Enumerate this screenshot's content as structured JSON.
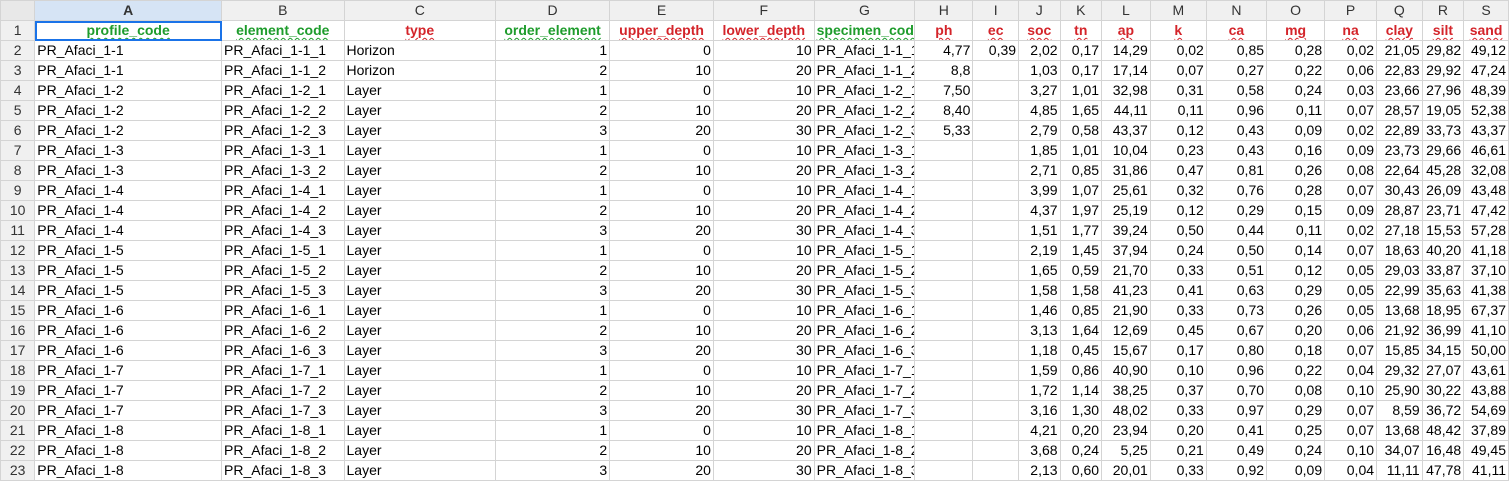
{
  "columns": [
    "A",
    "B",
    "C",
    "D",
    "E",
    "F",
    "G",
    "H",
    "I",
    "J",
    "K",
    "L",
    "M",
    "N",
    "O",
    "P",
    "Q",
    "R",
    "S"
  ],
  "headers": [
    {
      "text": "profile_code",
      "color": "g"
    },
    {
      "text": "element_code",
      "color": "g"
    },
    {
      "text": "type",
      "color": "r"
    },
    {
      "text": "order_element",
      "color": "g"
    },
    {
      "text": "upper_depth",
      "color": "r"
    },
    {
      "text": "lower_depth",
      "color": "r"
    },
    {
      "text": "specimen_code",
      "color": "g"
    },
    {
      "text": "ph",
      "color": "r"
    },
    {
      "text": "ec",
      "color": "r"
    },
    {
      "text": "soc",
      "color": "r"
    },
    {
      "text": "tn",
      "color": "r"
    },
    {
      "text": "ap",
      "color": "r"
    },
    {
      "text": "k",
      "color": "r"
    },
    {
      "text": "ca",
      "color": "r"
    },
    {
      "text": "mg",
      "color": "r"
    },
    {
      "text": "na",
      "color": "r"
    },
    {
      "text": "clay",
      "color": "r"
    },
    {
      "text": "silt",
      "color": "r"
    },
    {
      "text": "sand",
      "color": "r"
    }
  ],
  "rows": [
    [
      "PR_Afaci_1-1",
      "PR_Afaci_1-1_1",
      "Horizon",
      "1",
      "0",
      "10",
      "PR_Afaci_1-1_1",
      "4,77",
      "0,39",
      "2,02",
      "0,17",
      "14,29",
      "0,02",
      "0,85",
      "0,28",
      "0,02",
      "21,05",
      "29,82",
      "49,12"
    ],
    [
      "PR_Afaci_1-1",
      "PR_Afaci_1-1_2",
      "Horizon",
      "2",
      "10",
      "20",
      "PR_Afaci_1-1_2",
      "8,8",
      "",
      "1,03",
      "0,17",
      "17,14",
      "0,07",
      "0,27",
      "0,22",
      "0,06",
      "22,83",
      "29,92",
      "47,24"
    ],
    [
      "PR_Afaci_1-2",
      "PR_Afaci_1-2_1",
      "Layer",
      "1",
      "0",
      "10",
      "PR_Afaci_1-2_1",
      "7,50",
      "",
      "3,27",
      "1,01",
      "32,98",
      "0,31",
      "0,58",
      "0,24",
      "0,03",
      "23,66",
      "27,96",
      "48,39"
    ],
    [
      "PR_Afaci_1-2",
      "PR_Afaci_1-2_2",
      "Layer",
      "2",
      "10",
      "20",
      "PR_Afaci_1-2_2",
      "8,40",
      "",
      "4,85",
      "1,65",
      "44,11",
      "0,11",
      "0,96",
      "0,11",
      "0,07",
      "28,57",
      "19,05",
      "52,38"
    ],
    [
      "PR_Afaci_1-2",
      "PR_Afaci_1-2_3",
      "Layer",
      "3",
      "20",
      "30",
      "PR_Afaci_1-2_3",
      "5,33",
      "",
      "2,79",
      "0,58",
      "43,37",
      "0,12",
      "0,43",
      "0,09",
      "0,02",
      "22,89",
      "33,73",
      "43,37"
    ],
    [
      "PR_Afaci_1-3",
      "PR_Afaci_1-3_1",
      "Layer",
      "1",
      "0",
      "10",
      "PR_Afaci_1-3_1",
      "",
      "",
      "1,85",
      "1,01",
      "10,04",
      "0,23",
      "0,43",
      "0,16",
      "0,09",
      "23,73",
      "29,66",
      "46,61"
    ],
    [
      "PR_Afaci_1-3",
      "PR_Afaci_1-3_2",
      "Layer",
      "2",
      "10",
      "20",
      "PR_Afaci_1-3_2",
      "",
      "",
      "2,71",
      "0,85",
      "31,86",
      "0,47",
      "0,81",
      "0,26",
      "0,08",
      "22,64",
      "45,28",
      "32,08"
    ],
    [
      "PR_Afaci_1-4",
      "PR_Afaci_1-4_1",
      "Layer",
      "1",
      "0",
      "10",
      "PR_Afaci_1-4_1",
      "",
      "",
      "3,99",
      "1,07",
      "25,61",
      "0,32",
      "0,76",
      "0,28",
      "0,07",
      "30,43",
      "26,09",
      "43,48"
    ],
    [
      "PR_Afaci_1-4",
      "PR_Afaci_1-4_2",
      "Layer",
      "2",
      "10",
      "20",
      "PR_Afaci_1-4_2",
      "",
      "",
      "4,37",
      "1,97",
      "25,19",
      "0,12",
      "0,29",
      "0,15",
      "0,09",
      "28,87",
      "23,71",
      "47,42"
    ],
    [
      "PR_Afaci_1-4",
      "PR_Afaci_1-4_3",
      "Layer",
      "3",
      "20",
      "30",
      "PR_Afaci_1-4_3",
      "",
      "",
      "1,51",
      "1,77",
      "39,24",
      "0,50",
      "0,44",
      "0,11",
      "0,02",
      "27,18",
      "15,53",
      "57,28"
    ],
    [
      "PR_Afaci_1-5",
      "PR_Afaci_1-5_1",
      "Layer",
      "1",
      "0",
      "10",
      "PR_Afaci_1-5_1",
      "",
      "",
      "2,19",
      "1,45",
      "37,94",
      "0,24",
      "0,50",
      "0,14",
      "0,07",
      "18,63",
      "40,20",
      "41,18"
    ],
    [
      "PR_Afaci_1-5",
      "PR_Afaci_1-5_2",
      "Layer",
      "2",
      "10",
      "20",
      "PR_Afaci_1-5_2",
      "",
      "",
      "1,65",
      "0,59",
      "21,70",
      "0,33",
      "0,51",
      "0,12",
      "0,05",
      "29,03",
      "33,87",
      "37,10"
    ],
    [
      "PR_Afaci_1-5",
      "PR_Afaci_1-5_3",
      "Layer",
      "3",
      "20",
      "30",
      "PR_Afaci_1-5_3",
      "",
      "",
      "1,58",
      "1,58",
      "41,23",
      "0,41",
      "0,63",
      "0,29",
      "0,05",
      "22,99",
      "35,63",
      "41,38"
    ],
    [
      "PR_Afaci_1-6",
      "PR_Afaci_1-6_1",
      "Layer",
      "1",
      "0",
      "10",
      "PR_Afaci_1-6_1",
      "",
      "",
      "1,46",
      "0,85",
      "21,90",
      "0,33",
      "0,73",
      "0,26",
      "0,05",
      "13,68",
      "18,95",
      "67,37"
    ],
    [
      "PR_Afaci_1-6",
      "PR_Afaci_1-6_2",
      "Layer",
      "2",
      "10",
      "20",
      "PR_Afaci_1-6_2",
      "",
      "",
      "3,13",
      "1,64",
      "12,69",
      "0,45",
      "0,67",
      "0,20",
      "0,06",
      "21,92",
      "36,99",
      "41,10"
    ],
    [
      "PR_Afaci_1-6",
      "PR_Afaci_1-6_3",
      "Layer",
      "3",
      "20",
      "30",
      "PR_Afaci_1-6_3",
      "",
      "",
      "1,18",
      "0,45",
      "15,67",
      "0,17",
      "0,80",
      "0,18",
      "0,07",
      "15,85",
      "34,15",
      "50,00"
    ],
    [
      "PR_Afaci_1-7",
      "PR_Afaci_1-7_1",
      "Layer",
      "1",
      "0",
      "10",
      "PR_Afaci_1-7_1",
      "",
      "",
      "1,59",
      "0,86",
      "40,90",
      "0,10",
      "0,96",
      "0,22",
      "0,04",
      "29,32",
      "27,07",
      "43,61"
    ],
    [
      "PR_Afaci_1-7",
      "PR_Afaci_1-7_2",
      "Layer",
      "2",
      "10",
      "20",
      "PR_Afaci_1-7_2",
      "",
      "",
      "1,72",
      "1,14",
      "38,25",
      "0,37",
      "0,70",
      "0,08",
      "0,10",
      "25,90",
      "30,22",
      "43,88"
    ],
    [
      "PR_Afaci_1-7",
      "PR_Afaci_1-7_3",
      "Layer",
      "3",
      "20",
      "30",
      "PR_Afaci_1-7_3",
      "",
      "",
      "3,16",
      "1,30",
      "48,02",
      "0,33",
      "0,97",
      "0,29",
      "0,07",
      "8,59",
      "36,72",
      "54,69"
    ],
    [
      "PR_Afaci_1-8",
      "PR_Afaci_1-8_1",
      "Layer",
      "1",
      "0",
      "10",
      "PR_Afaci_1-8_1",
      "",
      "",
      "4,21",
      "0,20",
      "23,94",
      "0,20",
      "0,41",
      "0,25",
      "0,07",
      "13,68",
      "48,42",
      "37,89"
    ],
    [
      "PR_Afaci_1-8",
      "PR_Afaci_1-8_2",
      "Layer",
      "2",
      "10",
      "20",
      "PR_Afaci_1-8_2",
      "",
      "",
      "3,68",
      "0,24",
      "5,25",
      "0,21",
      "0,49",
      "0,24",
      "0,10",
      "34,07",
      "16,48",
      "49,45"
    ],
    [
      "PR_Afaci_1-8",
      "PR_Afaci_1-8_3",
      "Layer",
      "3",
      "20",
      "30",
      "PR_Afaci_1-8_3",
      "",
      "",
      "2,13",
      "0,60",
      "20,01",
      "0,33",
      "0,92",
      "0,09",
      "0,04",
      "11,11",
      "47,78",
      "41,11"
    ]
  ],
  "active_column": "A",
  "selected_cell": "A1"
}
